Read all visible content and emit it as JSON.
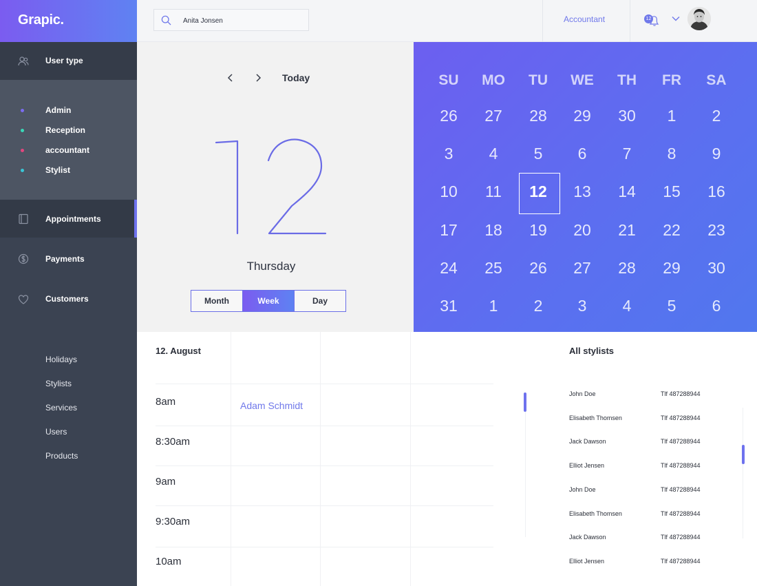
{
  "brand": {
    "name": "Grapic."
  },
  "sidebar": {
    "user_type_label": "User type",
    "user_types": [
      {
        "label": "Admin",
        "color": "#7b6cf0"
      },
      {
        "label": "Reception",
        "color": "#39d8b8"
      },
      {
        "label": "accountant",
        "color": "#e2467e"
      },
      {
        "label": "Stylist",
        "color": "#39c6d6"
      }
    ],
    "nav": [
      {
        "label": "Appointments",
        "icon": "calendar-book-icon",
        "active": true
      },
      {
        "label": "Payments",
        "icon": "dollar-icon",
        "active": false
      },
      {
        "label": "Customers",
        "icon": "heart-icon",
        "active": false
      }
    ],
    "sub_items": [
      "Holidays",
      "Stylists",
      "Services",
      "Users",
      "Products"
    ]
  },
  "header": {
    "search_value": "Anita Jonsen",
    "role": "Accountant",
    "notification_count": "12",
    "icons": [
      "search-icon",
      "bell-icon",
      "chevron-down-icon",
      "avatar"
    ]
  },
  "date_panel": {
    "today_label": "Today",
    "day_number": "12",
    "weekday": "Thursday",
    "views": [
      "Month",
      "Week",
      "Day"
    ],
    "selected_view": "Week"
  },
  "calendar": {
    "weekdays": [
      "SU",
      "MO",
      "TU",
      "WE",
      "TH",
      "FR",
      "SA"
    ],
    "weeks": [
      [
        "26",
        "27",
        "28",
        "29",
        "30",
        "1",
        "2"
      ],
      [
        "3",
        "4",
        "5",
        "6",
        "7",
        "8",
        "9"
      ],
      [
        "10",
        "11",
        "12",
        "13",
        "14",
        "15",
        "16"
      ],
      [
        "17",
        "18",
        "19",
        "20",
        "21",
        "22",
        "23"
      ],
      [
        "24",
        "25",
        "26",
        "27",
        "28",
        "29",
        "30"
      ],
      [
        "31",
        "1",
        "2",
        "3",
        "4",
        "5",
        "6"
      ]
    ],
    "selected_day": "12",
    "gradient": [
      "#6c5ff0",
      "#5177ee"
    ]
  },
  "schedule": {
    "date": "12. August",
    "times": [
      "8am",
      "8:30am",
      "9am",
      "9:30am",
      "10am"
    ],
    "appointment": "Adam Schmidt"
  },
  "stylists": {
    "title": "All stylists",
    "rows": [
      {
        "name": "John Doe",
        "phone": "Tlf 487288944"
      },
      {
        "name": "Elisabeth Thomsen",
        "phone": "Tlf 487288944"
      },
      {
        "name": "Jack Dawson",
        "phone": "Tlf 487288944"
      },
      {
        "name": "Elliot Jensen",
        "phone": "Tlf 487288944"
      },
      {
        "name": "John Doe",
        "phone": "Tlf 487288944"
      },
      {
        "name": "Elisabeth Thomsen",
        "phone": "Tlf 487288944"
      },
      {
        "name": "Jack Dawson",
        "phone": "Tlf 487288944"
      },
      {
        "name": "Elliot Jensen",
        "phone": "Tlf 487288944"
      }
    ]
  },
  "colors": {
    "accent": "#6f78ea",
    "sidebar": "#3b4352"
  }
}
